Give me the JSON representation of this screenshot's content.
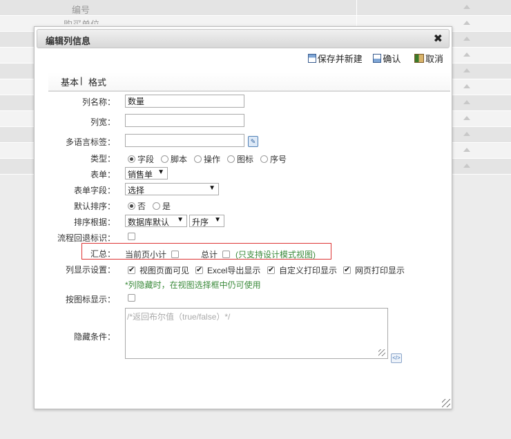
{
  "background": {
    "header_label": "编号",
    "partial_label": "购买单位",
    "row_count": 11
  },
  "dialog": {
    "title": "编辑列信息",
    "close": "✖",
    "toolbar": {
      "save_new": "保存并新建",
      "confirm": "确认",
      "cancel": "取消"
    },
    "tabs": {
      "basic": "基本",
      "separator": "|",
      "format": "格式"
    },
    "form": {
      "col_name_label": "列名称：",
      "col_name_value": "数量",
      "col_width_label": "列宽：",
      "col_width_value": "",
      "multi_lang_label": "多语言标签：",
      "multi_lang_value": "",
      "type_label": "类型：",
      "type_options": [
        "字段",
        "脚本",
        "操作",
        "图标",
        "序号"
      ],
      "type_selected": "字段",
      "form_label": "表单：",
      "form_value": "销售单",
      "form_field_label": "表单字段：",
      "form_field_value": "选择",
      "default_sort_label": "默认排序：",
      "default_sort_no": "否",
      "default_sort_yes": "是",
      "default_sort_selected": "否",
      "sort_by_label": "排序根据：",
      "sort_by_value": "数据库默认",
      "sort_order_value": "升序",
      "flow_return_label": "流程回退标识：",
      "summary_label": "汇总：",
      "summary_page_subtotal": "当前页小计",
      "summary_total": "总计",
      "summary_note": "(只支持设计模式视图)",
      "display_label": "列显示设置：",
      "display_view": "视图页面可见",
      "display_excel": "Excel导出显示",
      "display_custom_print": "自定义打印显示",
      "display_web_print": "网页打印显示",
      "display_hint": "*列隐藏时，在视图选择框中仍可使用",
      "icon_display_label": "按图标显示：",
      "hide_condition_label": "隐藏条件：",
      "hide_condition_placeholder": "/*返回布尔值（true/false）*/"
    }
  }
}
